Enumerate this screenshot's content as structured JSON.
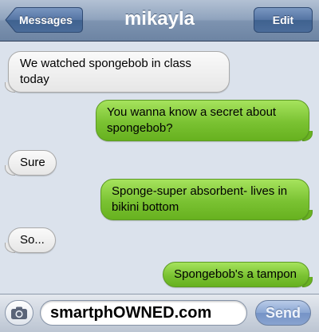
{
  "nav": {
    "back_label": "Messages",
    "title": "mikayla",
    "edit_label": "Edit"
  },
  "messages": [
    {
      "direction": "incoming",
      "text": "We watched spongebob in class today"
    },
    {
      "direction": "outgoing",
      "text": "You wanna know a secret about spongebob?"
    },
    {
      "direction": "incoming",
      "text": "Sure"
    },
    {
      "direction": "outgoing",
      "text": "Sponge-super absorbent- lives in bikini bottom"
    },
    {
      "direction": "incoming",
      "text": "So..."
    },
    {
      "direction": "outgoing",
      "text": "Spongebob's a tampon"
    }
  ],
  "input": {
    "camera_icon": "camera-icon",
    "value": "smartphOWNED.com",
    "send_label": "Send"
  },
  "colors": {
    "outgoing_bubble": "#7ac232",
    "incoming_bubble": "#eeeeee",
    "background": "#dbe2ec",
    "navbar": "#8fa3bd"
  }
}
